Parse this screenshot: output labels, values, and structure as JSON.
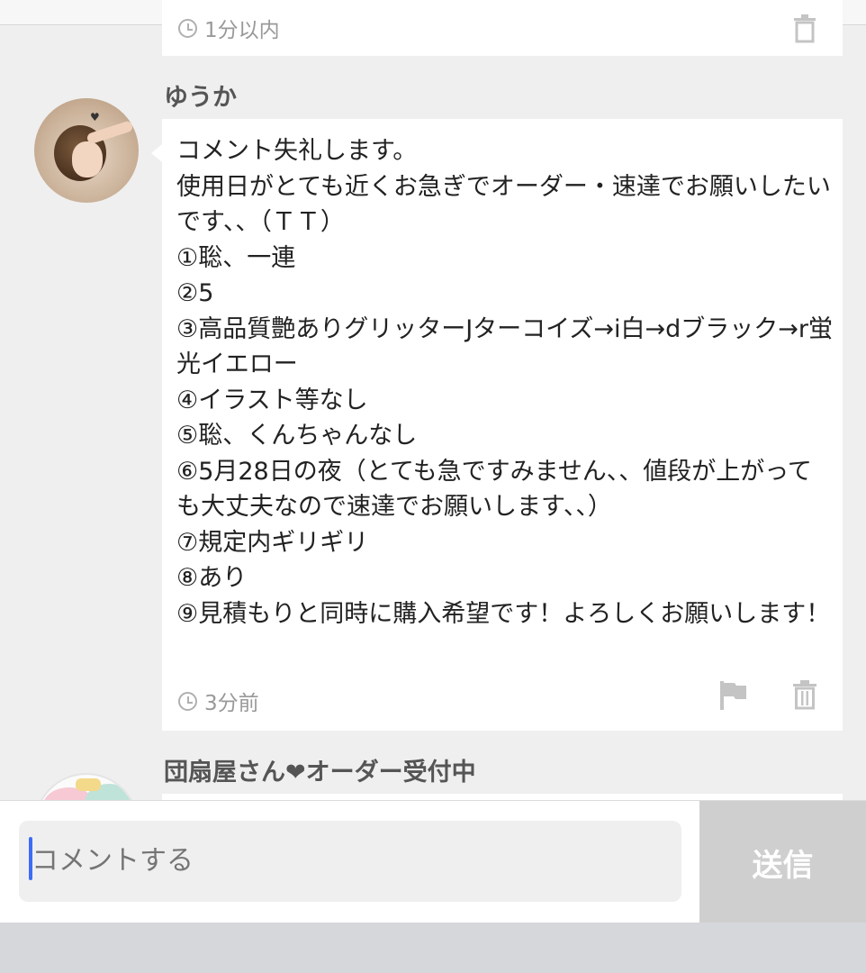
{
  "previous_comment": {
    "timestamp": "1分以内"
  },
  "comment": {
    "username": "ゆうか",
    "text": "コメント失礼します。\n使用日がとても近くお急ぎでオーダー・速達でお願いしたいです、、（ＴＴ）\n①聡、一連\n②5\n③高品質艶ありグリッターJターコイズ→i白→dブラック→r蛍光イエロー\n④イラスト等なし\n⑤聡、くんちゃんなし\n⑥5月28日の夜（とても急ですみません、、値段が上がっても大丈夫なので速達でお願いします、、）\n⑦規定内ギリギリ\n⑧あり\n⑨見積もりと同時に購入希望です！よろしくお願いします！",
    "timestamp": "3分前",
    "icons": {
      "time": "clock-icon",
      "report": "flag-icon",
      "delete": "trash-icon"
    }
  },
  "next_comment": {
    "username": "団扇屋さん❤オーダー受付中"
  },
  "composer": {
    "placeholder": "コメントする",
    "send_label": "送信"
  },
  "colors": {
    "background": "#efefef",
    "bubble": "#ffffff",
    "send_button": "#cfcfcf",
    "caret": "#3d6cf5"
  }
}
